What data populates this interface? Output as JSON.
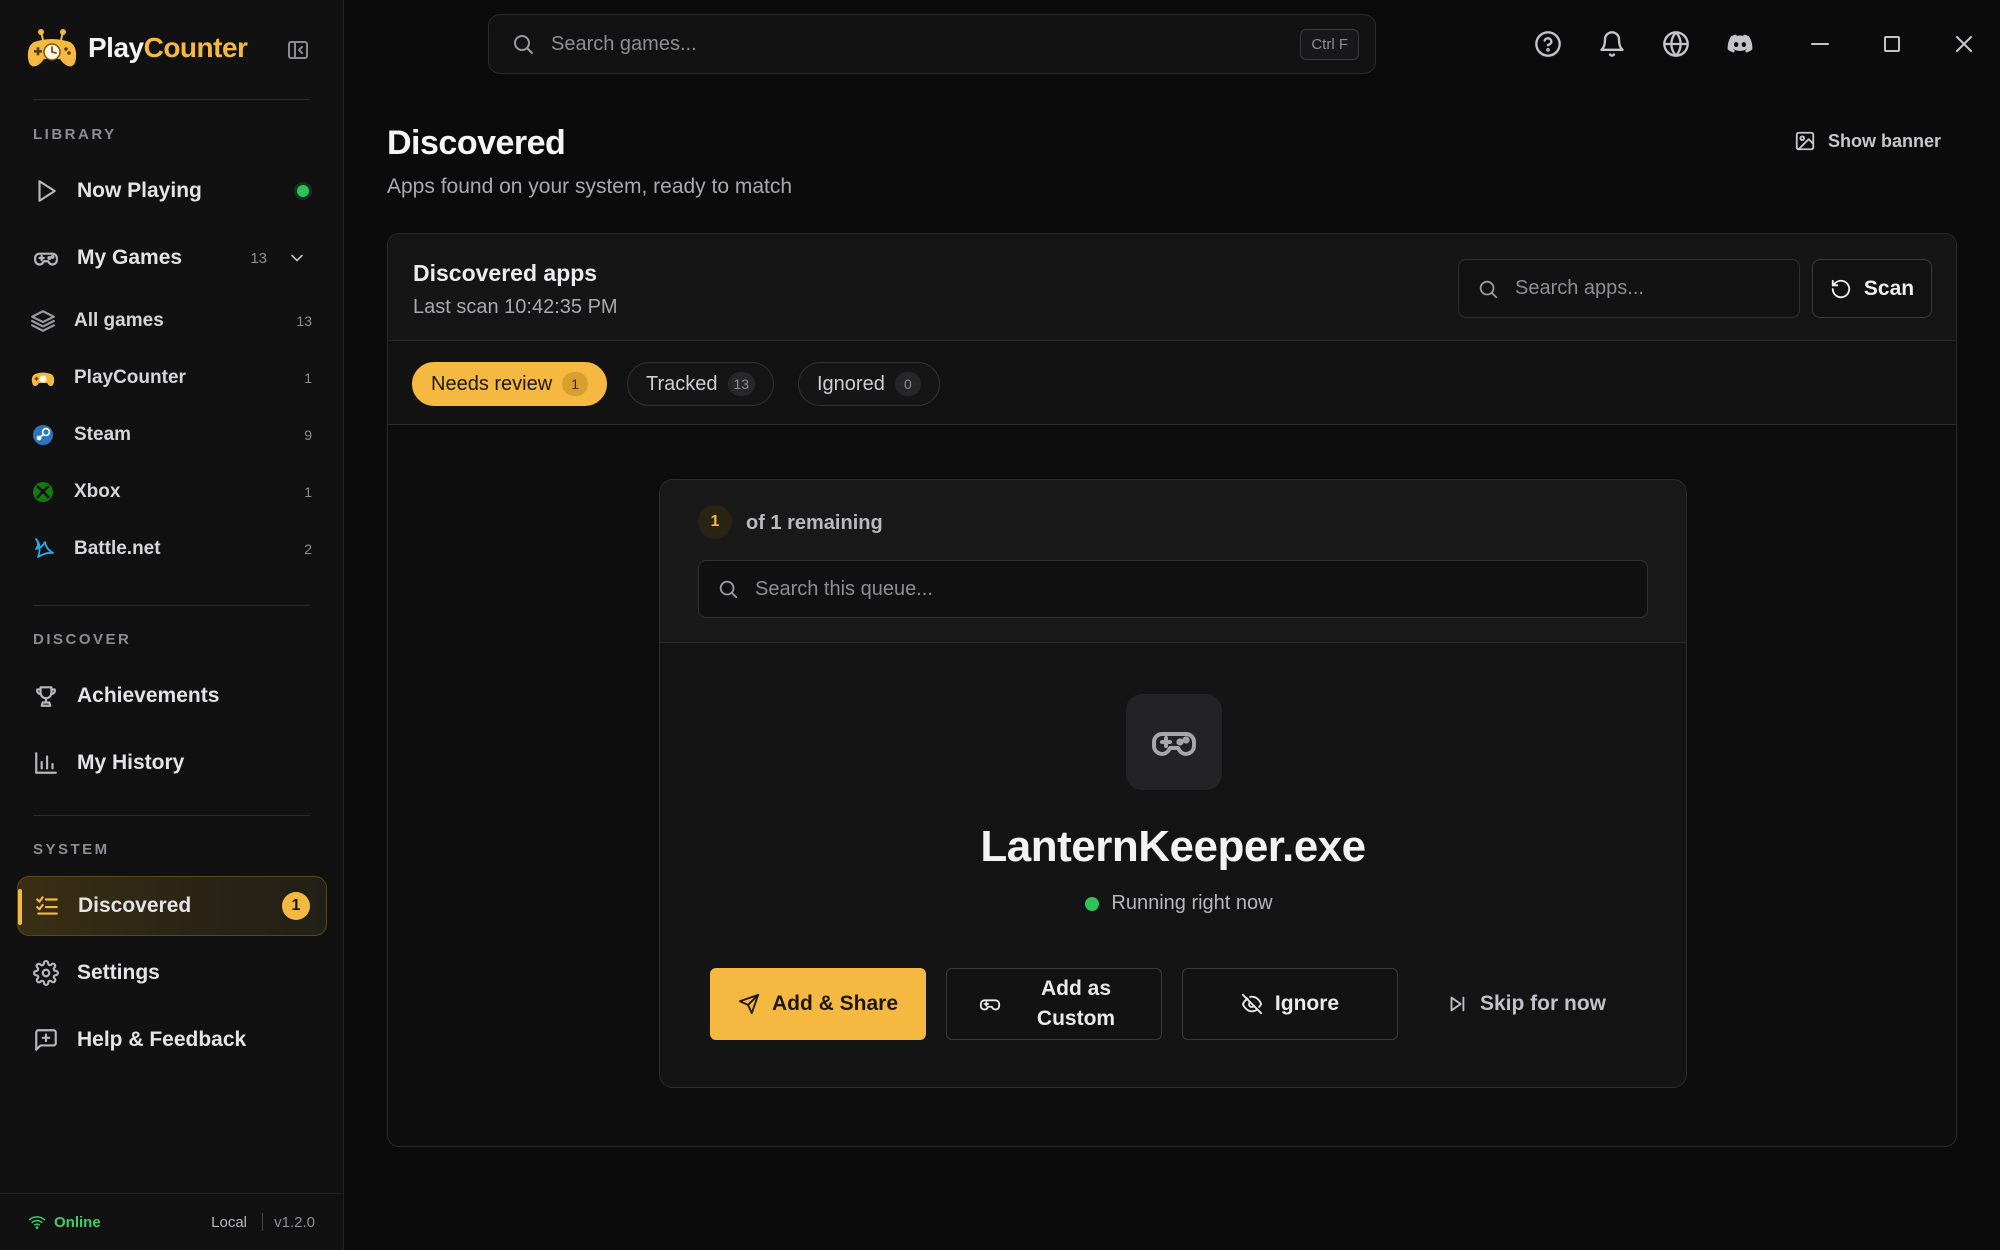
{
  "app": {
    "name_part1": "Play",
    "name_part2": "Counter",
    "accent_color": "#f5b942"
  },
  "topbar": {
    "search_placeholder": "Search games...",
    "search_shortcut": "Ctrl F",
    "icons": [
      "help-circle-icon",
      "bell-icon",
      "globe-icon",
      "discord-icon"
    ],
    "window_controls": [
      "minimize-icon",
      "maximize-icon",
      "close-icon"
    ]
  },
  "sidebar": {
    "library_label": "LIBRARY",
    "now_playing": {
      "label": "Now Playing",
      "status_color": "#2fc25b"
    },
    "my_games": {
      "label": "My Games",
      "count": "13"
    },
    "platforms": [
      {
        "label": "All games",
        "count": "13",
        "icon": "layers-icon"
      },
      {
        "label": "PlayCounter",
        "count": "1",
        "icon": "playcounter-icon"
      },
      {
        "label": "Steam",
        "count": "9",
        "icon": "steam-icon"
      },
      {
        "label": "Xbox",
        "count": "1",
        "icon": "xbox-icon"
      },
      {
        "label": "Battle.net",
        "count": "2",
        "icon": "battlenet-icon"
      }
    ],
    "discover_label": "DISCOVER",
    "achievements": "Achievements",
    "history": "My History",
    "system_label": "SYSTEM",
    "discovered": {
      "label": "Discovered",
      "badge": "1"
    },
    "settings": "Settings",
    "help": "Help & Feedback",
    "footer": {
      "status": "Online",
      "mode": "Local",
      "version": "v1.2.0"
    }
  },
  "page": {
    "title": "Discovered",
    "subtitle": "Apps found on your system, ready to match",
    "banner_label": "Show banner"
  },
  "panel": {
    "title": "Discovered apps",
    "last_scan": "Last scan 10:42:35 PM",
    "search_placeholder": "Search apps...",
    "scan_label": "Scan",
    "tabs": [
      {
        "label": "Needs review",
        "count": "1",
        "active": true
      },
      {
        "label": "Tracked",
        "count": "13",
        "active": false
      },
      {
        "label": "Ignored",
        "count": "0",
        "active": false
      }
    ]
  },
  "queue": {
    "position": "1",
    "remaining_text": "of 1 remaining",
    "search_placeholder": "Search this queue...",
    "app_name": "LanternKeeper.exe",
    "status": "Running right now",
    "status_color": "#2fc25b",
    "actions": {
      "add_share": "Add & Share",
      "add_custom_line1": "Add as",
      "add_custom_line2": "Custom",
      "ignore": "Ignore",
      "skip": "Skip for now"
    }
  }
}
